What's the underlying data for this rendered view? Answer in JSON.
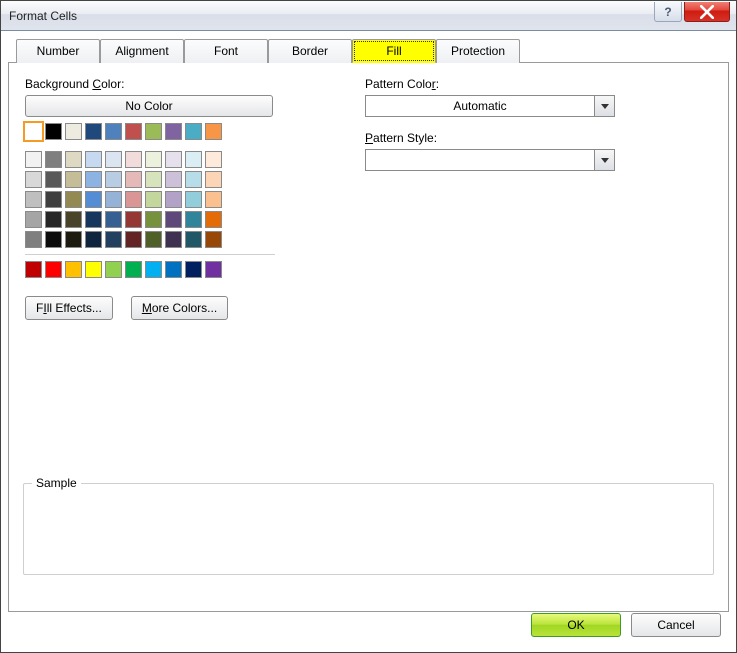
{
  "title": "Format Cells",
  "tabs": [
    "Number",
    "Alignment",
    "Font",
    "Border",
    "Fill",
    "Protection"
  ],
  "active_tab": "Fill",
  "left": {
    "bg_label_pre": "Background ",
    "bg_label_u": "C",
    "bg_label_post": "olor:",
    "no_color": "No Color",
    "fill_effects_u": "I",
    "fill_effects_pre": "F",
    "fill_effects_post": "ll Effects...",
    "more_colors_u": "M",
    "more_colors_post": "ore Colors..."
  },
  "right": {
    "pattern_color_pre": "Pattern Colo",
    "pattern_color_u": "r",
    "pattern_color_post": ":",
    "pattern_color_value": "Automatic",
    "pattern_style_u": "P",
    "pattern_style_post": "attern Style:",
    "pattern_style_value": ""
  },
  "sample_label": "Sample",
  "ok": "OK",
  "cancel": "Cancel",
  "palette_top": [
    [
      "#ffffff",
      "#000000",
      "#eeece1",
      "#1f497d",
      "#4f81bd",
      "#c0504d",
      "#9bbb59",
      "#8064a2",
      "#4bacc6",
      "#f79646"
    ]
  ],
  "palette_theme": [
    [
      "#f2f2f2",
      "#7f7f7f",
      "#ddd9c3",
      "#c6d9f0",
      "#dbe5f1",
      "#f2dcdb",
      "#ebf1dd",
      "#e5e0ec",
      "#dbeef3",
      "#fdeada"
    ],
    [
      "#d8d8d8",
      "#595959",
      "#c4bd97",
      "#8db3e2",
      "#b8cce4",
      "#e5b9b7",
      "#d7e3bc",
      "#ccc1d9",
      "#b7dde8",
      "#fbd5b5"
    ],
    [
      "#bfbfbf",
      "#3f3f3f",
      "#938953",
      "#548dd4",
      "#95b3d7",
      "#d99694",
      "#c3d69b",
      "#b2a2c7",
      "#92cddc",
      "#fac08f"
    ],
    [
      "#a5a5a5",
      "#262626",
      "#494429",
      "#17365d",
      "#366092",
      "#953734",
      "#76923c",
      "#5f497a",
      "#31859b",
      "#e36c09"
    ],
    [
      "#7f7f7f",
      "#0c0c0c",
      "#1d1b10",
      "#0f243e",
      "#244061",
      "#632423",
      "#4f6128",
      "#3f3151",
      "#205867",
      "#974806"
    ]
  ],
  "palette_standard": [
    [
      "#c00000",
      "#ff0000",
      "#ffc000",
      "#ffff00",
      "#92d050",
      "#00b050",
      "#00b0f0",
      "#0070c0",
      "#002060",
      "#7030a0"
    ]
  ]
}
